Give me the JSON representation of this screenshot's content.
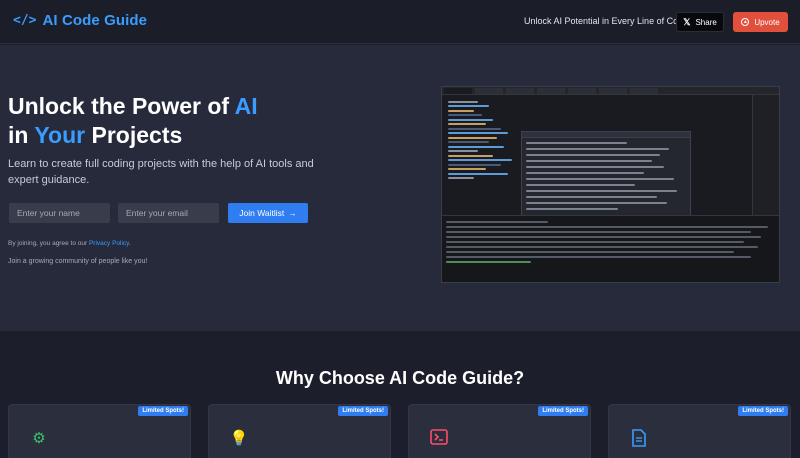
{
  "header": {
    "logo_icon": "</>",
    "logo_text": "AI Code Guide",
    "tagline": "Unlock AI Potential in Every Line of Code",
    "share_label": "Share",
    "upvote_label": "Upvote"
  },
  "hero": {
    "title_line1_pre": "Unlock the Power of ",
    "title_line1_hl": "AI",
    "title_line2_pre": "in ",
    "title_line2_hl": "Your",
    "title_line2_post": " Projects",
    "subtitle": "Learn to create full coding projects with the help of AI tools and expert guidance.",
    "name_placeholder": "Enter your name",
    "email_placeholder": "Enter your email",
    "join_label": "Join Waitlist",
    "privacy_pre": "By joining, you agree to our ",
    "privacy_link": "Privacy Policy",
    "privacy_post": ".",
    "community": "Join a growing community of people like you!"
  },
  "features": {
    "title": "Why Choose AI Code Guide?",
    "cards": [
      {
        "badge": "Limited Spots!",
        "icon": "gear-icon"
      },
      {
        "badge": "Limited Spots!",
        "icon": "lightbulb-icon"
      },
      {
        "badge": "Limited Spots!",
        "icon": "terminal-icon"
      },
      {
        "badge": "Limited Spots!",
        "icon": "document-icon"
      }
    ]
  },
  "colors": {
    "accent": "#3b9cff",
    "join_button": "#2f7df1",
    "upvote_button": "#e0503c"
  }
}
